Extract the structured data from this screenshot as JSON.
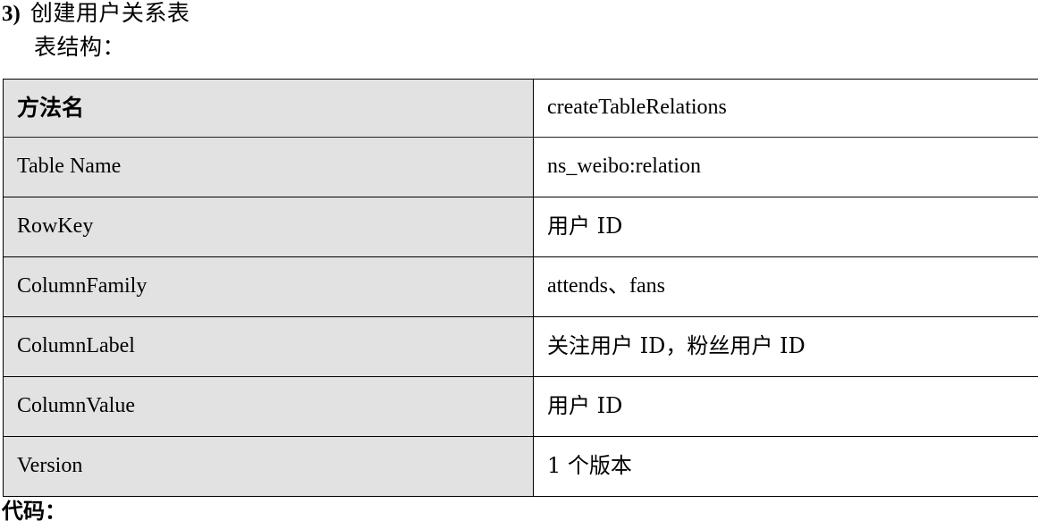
{
  "document": {
    "section_number": "3)",
    "section_title": "创建用户关系表",
    "subsection_label": "表结构：",
    "footer_label": "代码："
  },
  "table": {
    "header": {
      "key": "方法名",
      "value": "createTableRelations"
    },
    "rows": [
      {
        "key": "Table Name",
        "value": "ns_weibo:relation"
      },
      {
        "key": "RowKey",
        "value": "用户 ID"
      },
      {
        "key": "ColumnFamily",
        "value": "attends、fans"
      },
      {
        "key": "ColumnLabel",
        "value": "关注用户 ID，粉丝用户 ID"
      },
      {
        "key": "ColumnValue",
        "value": "用户 ID"
      },
      {
        "key": "Version",
        "value": "1 个版本"
      }
    ]
  },
  "colors": {
    "key_column_background": "#e2e2e2",
    "value_column_background": "#ffffff",
    "border": "#000000",
    "text": "#000000",
    "page_background": "#ffffff"
  }
}
